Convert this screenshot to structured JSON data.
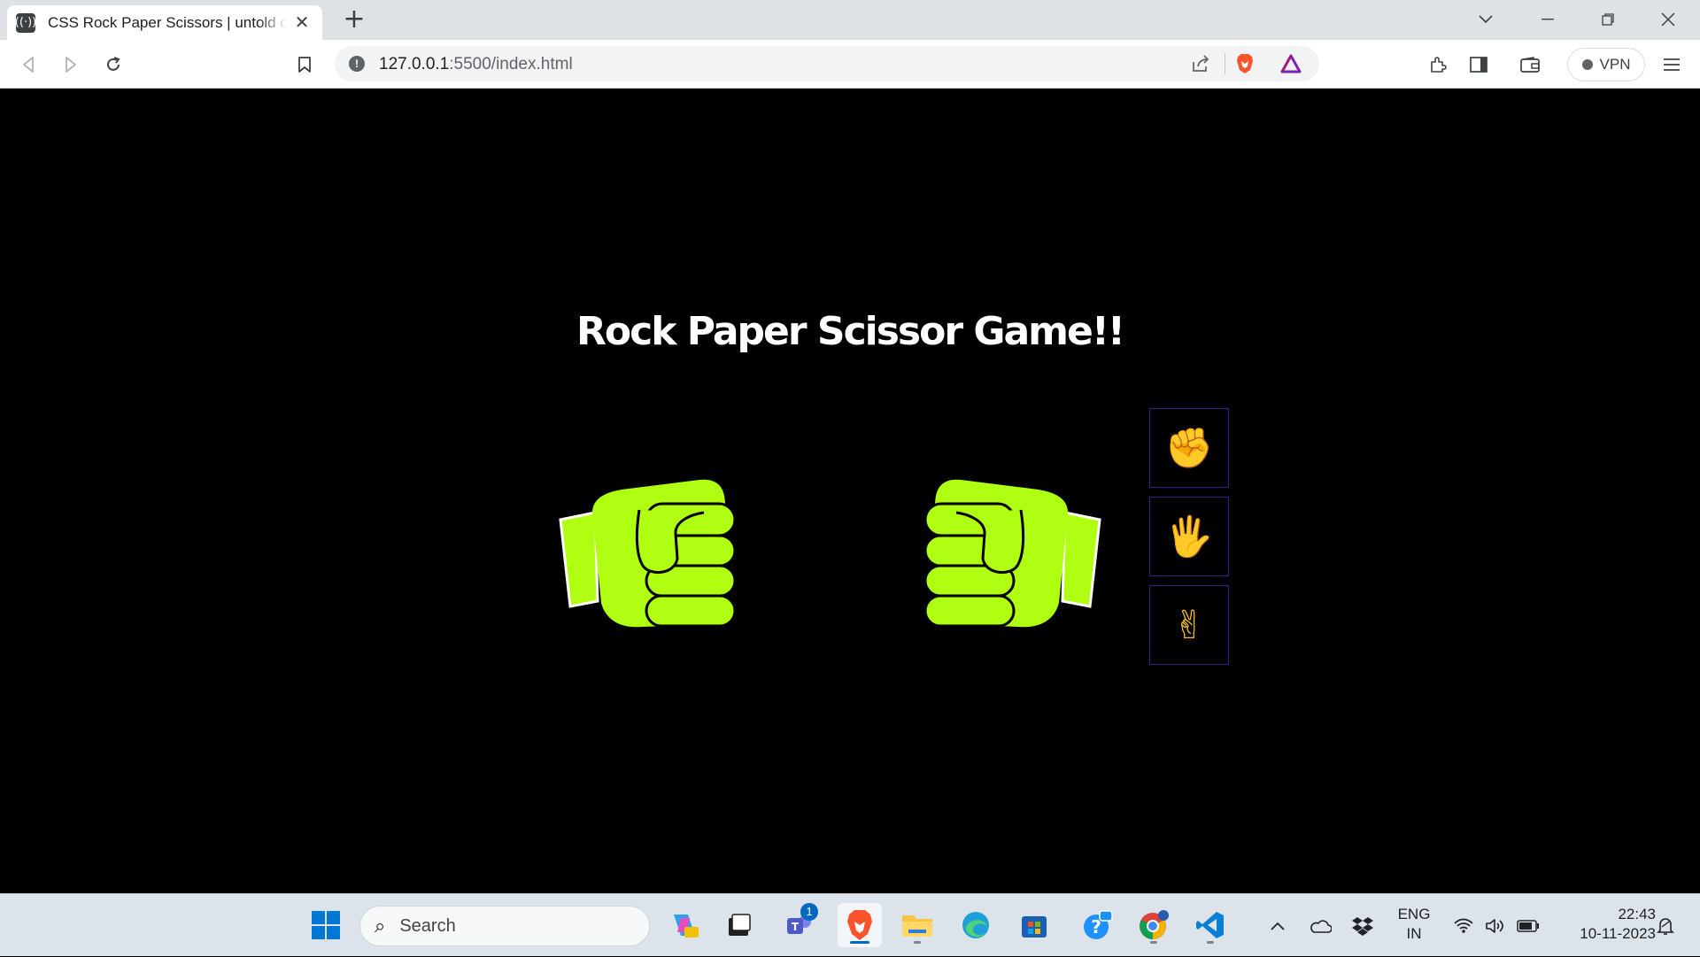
{
  "browser": {
    "tab": {
      "favicon": "broadcast-icon",
      "title": "CSS Rock Paper Scissors | untold design"
    },
    "address": {
      "host": "127.0.0.1",
      "path": ":5500/index.html"
    },
    "vpn_label": "VPN"
  },
  "page": {
    "title": "Rock Paper Scissor Game!!",
    "hand_color": "#b0ff12",
    "choices": [
      {
        "name": "rock",
        "emoji": "✊"
      },
      {
        "name": "paper",
        "emoji": "🖐"
      },
      {
        "name": "scissors",
        "emoji": "✌"
      }
    ],
    "choice_border_color": "#3a1d8a"
  },
  "taskbar": {
    "search_placeholder": "Search",
    "teams_badge": "1",
    "language": {
      "line1": "ENG",
      "line2": "IN"
    },
    "clock": {
      "time": "22:43",
      "date": "10-11-2023"
    }
  }
}
